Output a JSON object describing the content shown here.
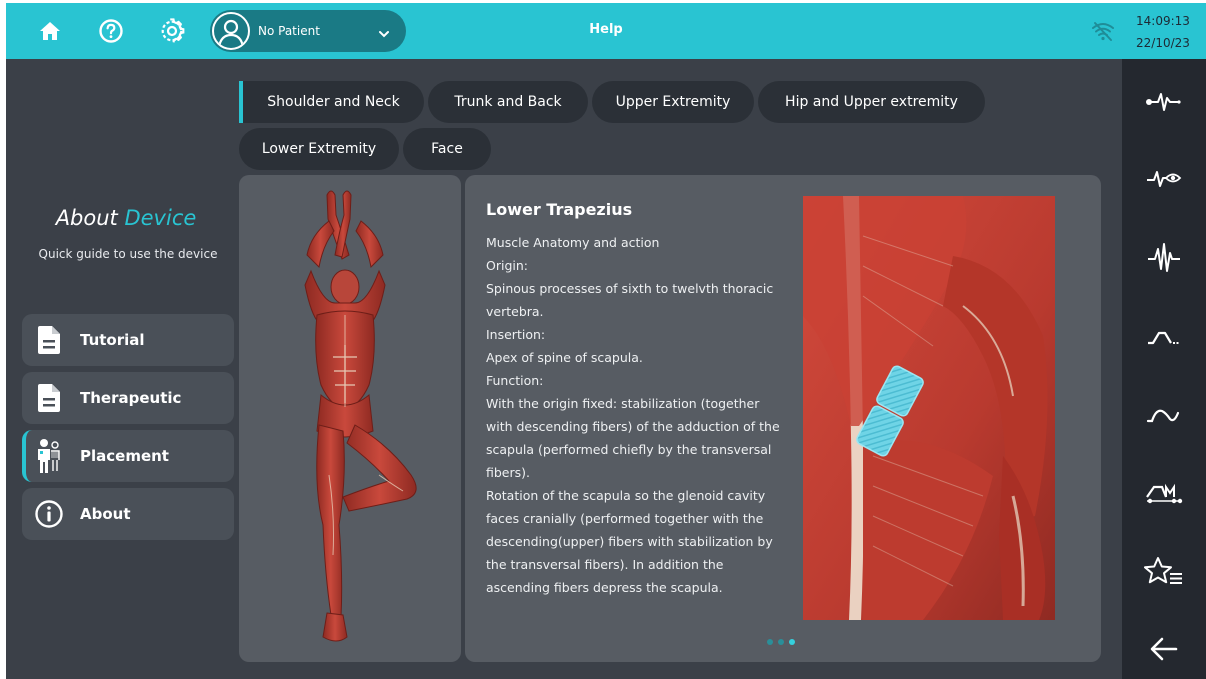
{
  "topbar": {
    "title": "Help",
    "patient": "No Patient",
    "time": "14:09:13",
    "date": "22/10/23",
    "icons": [
      "home-icon",
      "help-icon",
      "gear-icon",
      "avatar-icon",
      "chevron-down-icon",
      "wifi-off-icon"
    ]
  },
  "sidebar": {
    "title_main": "About",
    "title_accent": "Device",
    "subtitle": "Quick guide to use the device",
    "items": [
      {
        "label": "Tutorial",
        "icon": "document-icon",
        "active": false
      },
      {
        "label": "Therapeutic",
        "icon": "document-icon",
        "active": false
      },
      {
        "label": "Placement",
        "icon": "body-anatomy-icon",
        "active": true
      },
      {
        "label": "About",
        "icon": "info-icon",
        "active": false
      }
    ]
  },
  "tabs": [
    {
      "label": "Shoulder and Neck",
      "active": true
    },
    {
      "label": "Trunk and Back",
      "active": false
    },
    {
      "label": "Upper Extremity",
      "active": false
    },
    {
      "label": "Hip and Upper extremity",
      "active": false
    },
    {
      "label": "Lower Extremity",
      "active": false
    },
    {
      "label": "Face",
      "active": false
    }
  ],
  "content": {
    "title": "Lower Trapezius",
    "lines": [
      "Muscle Anatomy and action",
      "Origin:",
      "Spinous processes of sixth to twelvth thoracic vertebra.",
      "Insertion:",
      "Apex of spine of scapula.",
      "Function:",
      "With the origin fixed: stabilization (together with descending fibers) of the adduction of the scapula (performed chiefly by the transversal fibers).",
      "Rotation of the scapula so the glenoid cavity faces cranially (performed together with the descending(upper) fibers with stabilization by the transversal fibers). In addition the ascending fibers depress the scapula."
    ],
    "pager": {
      "count": 3,
      "active_index": 2
    }
  },
  "rail_icons": [
    "ems-waveform-icon",
    "waveform-eye-icon",
    "emg-waveform-icon",
    "ramp-waveform-icon",
    "sine-wave-icon",
    "program-sequence-icon",
    "favorites-list-icon",
    "back-arrow-icon"
  ],
  "colors": {
    "accent": "#29c4d2",
    "topbar": "#29c4d2",
    "background": "#3b4048",
    "panel": "#575c63",
    "rail": "#24282f",
    "electrode": "#6fd4e6"
  }
}
